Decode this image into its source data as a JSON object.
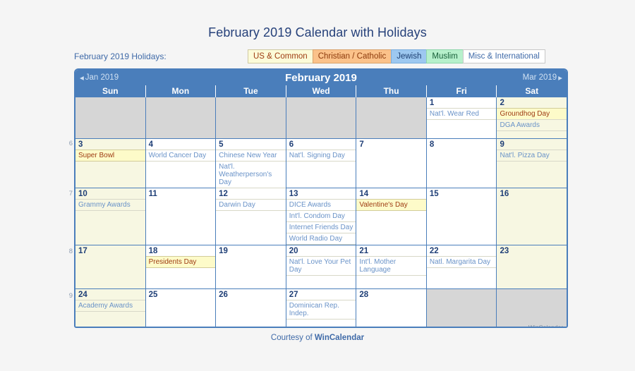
{
  "title": "February 2019 Calendar with Holidays",
  "legend": {
    "label": "February 2019 Holidays:",
    "chips": [
      {
        "label": "US & Common",
        "bg": "#fcfbd8",
        "fg": "#9e3b12"
      },
      {
        "label": "Christian / Catholic",
        "bg": "#fbc28a",
        "fg": "#8d3a0c"
      },
      {
        "label": "Jewish",
        "bg": "#9dc8f0",
        "fg": "#1d3f72"
      },
      {
        "label": "Muslim",
        "bg": "#b6f0cb",
        "fg": "#18603a"
      },
      {
        "label": "Misc & International",
        "bg": "#ffffff",
        "fg": "#3f6aa8"
      }
    ]
  },
  "calendar": {
    "prev_label": "Jan 2019",
    "month_label": "February 2019",
    "next_label": "Mar 2019",
    "daynames": [
      "Sun",
      "Mon",
      "Tue",
      "Wed",
      "Thu",
      "Fri",
      "Sat"
    ],
    "week_numbers": [
      "6",
      "7",
      "8",
      "9"
    ],
    "watermark": "WinCalendar",
    "weeks": [
      [
        {
          "num": "",
          "blank": true,
          "weekend": true,
          "events": []
        },
        {
          "num": "",
          "blank": true,
          "events": []
        },
        {
          "num": "",
          "blank": true,
          "events": []
        },
        {
          "num": "",
          "blank": true,
          "events": []
        },
        {
          "num": "",
          "blank": true,
          "events": []
        },
        {
          "num": "1",
          "events": [
            {
              "name": "Nat'l. Wear Red",
              "highlight": false
            }
          ]
        },
        {
          "num": "2",
          "weekend": true,
          "events": [
            {
              "name": "Groundhog Day",
              "highlight": true
            },
            {
              "name": "DGA Awards",
              "highlight": false
            }
          ]
        }
      ],
      [
        {
          "num": "3",
          "weekend": true,
          "events": [
            {
              "name": "Super Bowl",
              "highlight": true
            }
          ]
        },
        {
          "num": "4",
          "events": [
            {
              "name": "World Cancer Day",
              "highlight": false
            }
          ]
        },
        {
          "num": "5",
          "events": [
            {
              "name": "Chinese New Year",
              "highlight": false
            },
            {
              "name": "Nat'l. Weatherperson's Day",
              "highlight": false
            }
          ]
        },
        {
          "num": "6",
          "events": [
            {
              "name": "Nat'l. Signing Day",
              "highlight": false
            }
          ]
        },
        {
          "num": "7",
          "events": []
        },
        {
          "num": "8",
          "events": []
        },
        {
          "num": "9",
          "weekend": true,
          "events": [
            {
              "name": "Nat'l. Pizza Day",
              "highlight": false
            }
          ]
        }
      ],
      [
        {
          "num": "10",
          "weekend": true,
          "events": [
            {
              "name": "Grammy Awards",
              "highlight": false
            }
          ]
        },
        {
          "num": "11",
          "events": []
        },
        {
          "num": "12",
          "events": [
            {
              "name": "Darwin Day",
              "highlight": false
            }
          ]
        },
        {
          "num": "13",
          "events": [
            {
              "name": "DICE Awards",
              "highlight": false
            },
            {
              "name": "Int'l. Condom Day",
              "highlight": false
            },
            {
              "name": "Internet Friends Day",
              "highlight": false
            },
            {
              "name": "World Radio Day",
              "highlight": false
            }
          ]
        },
        {
          "num": "14",
          "events": [
            {
              "name": "Valentine's Day",
              "highlight": true
            }
          ]
        },
        {
          "num": "15",
          "events": []
        },
        {
          "num": "16",
          "weekend": true,
          "events": []
        }
      ],
      [
        {
          "num": "17",
          "weekend": true,
          "events": []
        },
        {
          "num": "18",
          "events": [
            {
              "name": "Presidents Day",
              "highlight": true
            }
          ]
        },
        {
          "num": "19",
          "events": []
        },
        {
          "num": "20",
          "events": [
            {
              "name": "Nat'l. Love Your Pet Day",
              "highlight": false
            }
          ]
        },
        {
          "num": "21",
          "events": [
            {
              "name": "Int'l. Mother Language",
              "highlight": false
            }
          ]
        },
        {
          "num": "22",
          "events": [
            {
              "name": "Natl. Margarita Day",
              "highlight": false
            }
          ]
        },
        {
          "num": "23",
          "weekend": true,
          "events": []
        }
      ],
      [
        {
          "num": "24",
          "weekend": true,
          "events": [
            {
              "name": "Academy Awards",
              "highlight": false
            }
          ]
        },
        {
          "num": "25",
          "events": []
        },
        {
          "num": "26",
          "events": []
        },
        {
          "num": "27",
          "events": [
            {
              "name": "Dominican Rep. Indep.",
              "highlight": false
            }
          ]
        },
        {
          "num": "28",
          "events": []
        },
        {
          "num": "",
          "blank": true,
          "events": []
        },
        {
          "num": "",
          "blank": true,
          "weekend": true,
          "watermark": true,
          "events": []
        }
      ]
    ]
  },
  "footer": {
    "prefix": "Courtesy of ",
    "brand": "WinCalendar"
  }
}
